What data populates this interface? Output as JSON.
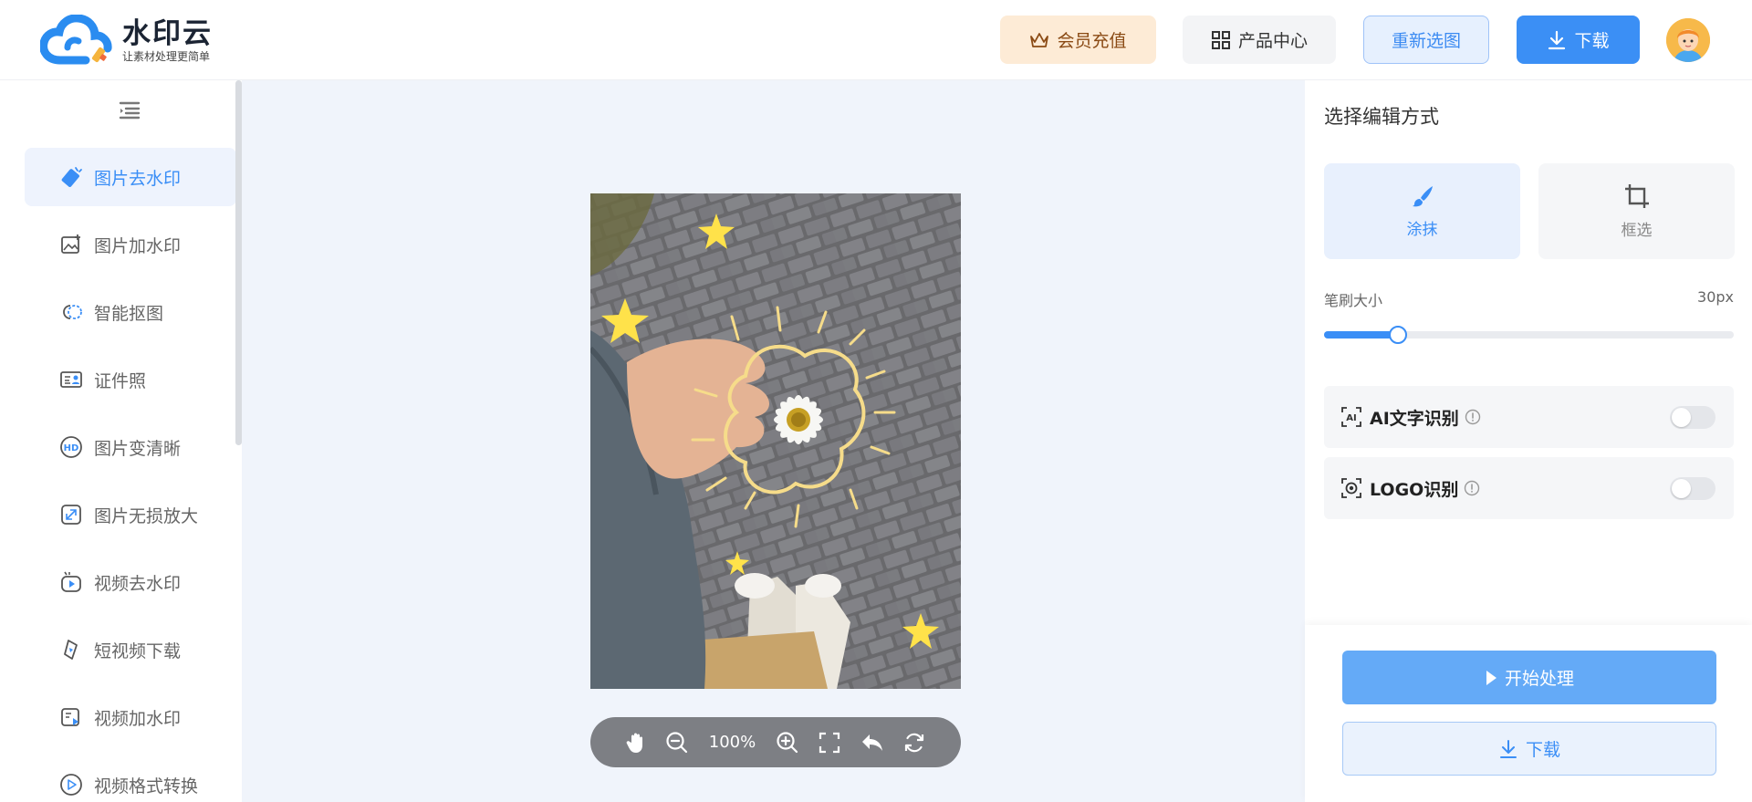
{
  "brand": {
    "title": "水印云",
    "subtitle": "让素材处理更简单"
  },
  "header": {
    "vip_label": "会员充值",
    "products_label": "产品中心",
    "reselect_label": "重新选图",
    "download_label": "下载"
  },
  "sidebar": {
    "items": [
      {
        "label": "图片去水印",
        "icon": "eraser-icon",
        "active": true
      },
      {
        "label": "图片加水印",
        "icon": "image-add-icon"
      },
      {
        "label": "智能抠图",
        "icon": "cutout-icon"
      },
      {
        "label": "证件照",
        "icon": "id-card-icon"
      },
      {
        "label": "图片变清晰",
        "icon": "hd-icon"
      },
      {
        "label": "图片无损放大",
        "icon": "enlarge-icon"
      },
      {
        "label": "视频去水印",
        "icon": "video-eraser-icon"
      },
      {
        "label": "短视频下载",
        "icon": "short-video-icon"
      },
      {
        "label": "视频加水印",
        "icon": "video-add-icon"
      },
      {
        "label": "视频格式转换",
        "icon": "video-convert-icon"
      }
    ]
  },
  "canvas": {
    "zoom": "100%"
  },
  "panel": {
    "title": "选择编辑方式",
    "modes": [
      {
        "label": "涂抹",
        "icon": "brush-icon",
        "active": true
      },
      {
        "label": "框选",
        "icon": "crop-icon"
      }
    ],
    "brush": {
      "label": "笔刷大小",
      "value_text": "30px",
      "fraction": 0.18
    },
    "options": [
      {
        "label": "AI文字识别",
        "icon": "ai-text-icon",
        "enabled": false
      },
      {
        "label": "LOGO识别",
        "icon": "logo-detect-icon",
        "enabled": false
      }
    ],
    "start_label": "开始处理",
    "download_label": "下载"
  },
  "colors": {
    "accent": "#3a8ef6",
    "vip_bg": "#fdebd6"
  }
}
